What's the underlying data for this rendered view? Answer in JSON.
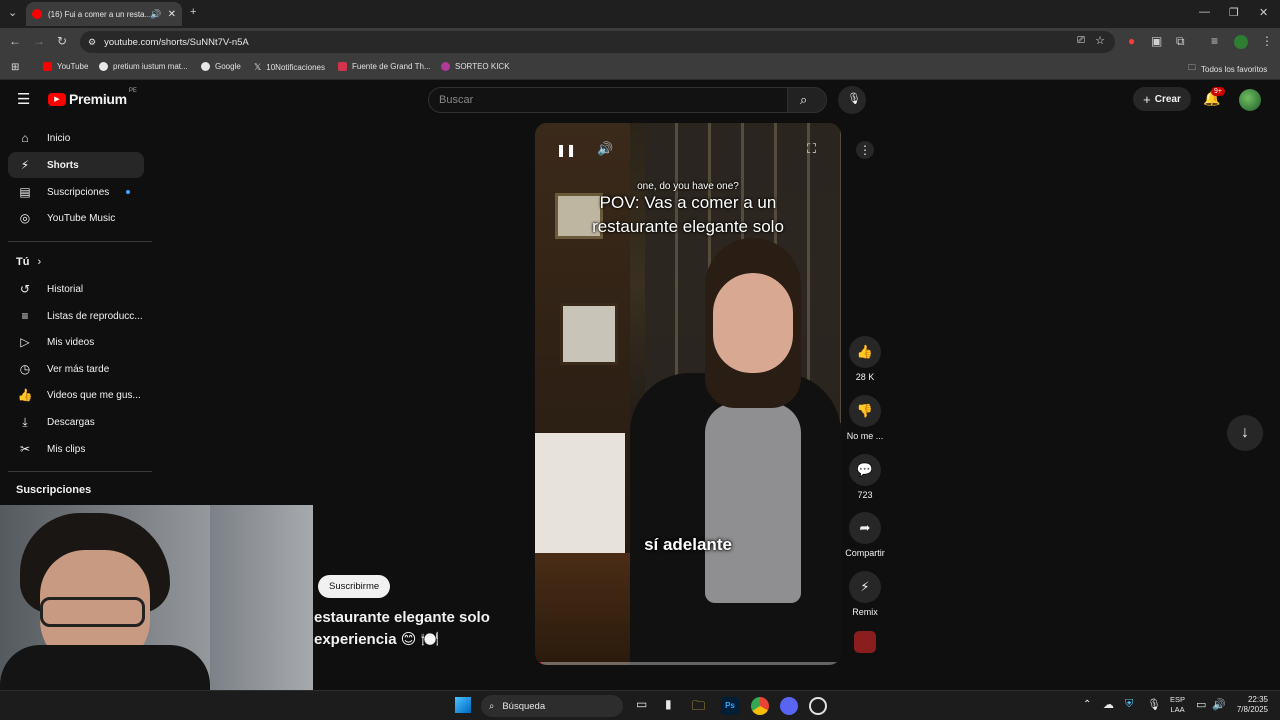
{
  "browser": {
    "tab_title": "(16) Fui a comer a un resta...",
    "url": "youtube.com/shorts/SuNNt7V-n5A",
    "bookmarks": [
      {
        "label": "YouTube",
        "icon": "youtube-icon",
        "color": "#ff0000"
      },
      {
        "label": "pretium iustum mat...",
        "icon": "google-icon",
        "color": "#e8e8e8"
      },
      {
        "label": "Google",
        "icon": "google-icon",
        "color": "#e8e8e8"
      },
      {
        "label": "10Notificaciones",
        "icon": "x-icon",
        "color": "#ffffff"
      },
      {
        "label": "Fuente de Grand Th...",
        "icon": "fandom-icon",
        "color": "#d4344b"
      },
      {
        "label": "SORTEO KICK",
        "icon": "kick-icon",
        "color": "#b03a9a"
      }
    ],
    "all_bookmarks": "Todos los favoritos"
  },
  "header": {
    "logo_text": "Premium",
    "logo_badge": "PE",
    "search_placeholder": "Buscar",
    "create_label": "Crear",
    "notif_count": "9+"
  },
  "sidebar": {
    "items": [
      {
        "label": "Inicio",
        "icon": "home-icon"
      },
      {
        "label": "Shorts",
        "icon": "shorts-icon"
      },
      {
        "label": "Suscripciones",
        "icon": "subscriptions-icon"
      },
      {
        "label": "YouTube Music",
        "icon": "music-icon"
      }
    ],
    "you_label": "Tú",
    "you_items": [
      {
        "label": "Historial",
        "icon": "history-icon"
      },
      {
        "label": "Listas de reproducc...",
        "icon": "playlist-icon"
      },
      {
        "label": "Mis videos",
        "icon": "video-icon"
      },
      {
        "label": "Ver más tarde",
        "icon": "clock-icon"
      },
      {
        "label": "Videos que me gus...",
        "icon": "like-icon"
      },
      {
        "label": "Descargas",
        "icon": "download-icon"
      },
      {
        "label": "Mis clips",
        "icon": "scissors-icon"
      }
    ],
    "subs_label": "Suscripciones"
  },
  "short": {
    "subtitle_top": "one, do you have one?",
    "title_overlay": "POV: Vas a comer a un restaurante elegante solo",
    "caption": "sí adelante",
    "progress": 0.02,
    "subscribe_label": "Suscribirme",
    "desc_line1": "estaurante elegante solo",
    "desc_line2": "experiencia 😊 🍽️"
  },
  "actions": {
    "likes": "28 K",
    "dislike": "No me ...",
    "comments": "723",
    "share": "Compartir",
    "remix": "Remix"
  },
  "taskbar": {
    "search_label": "Búsqueda",
    "lang_top": "ESP",
    "lang_bottom": "LAA",
    "time": "22:35",
    "date": "7/8/2025"
  }
}
